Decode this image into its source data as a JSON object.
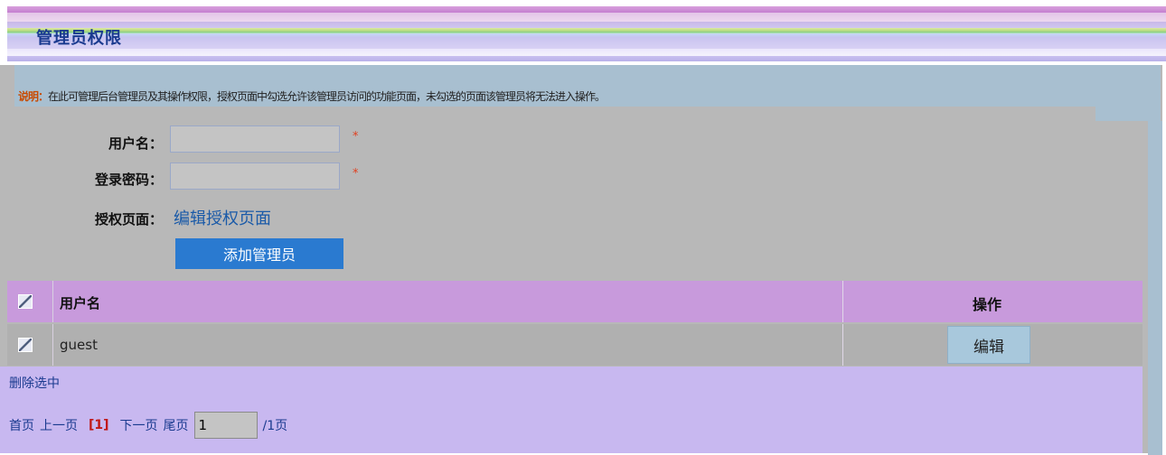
{
  "header": {
    "title": "管理员权限"
  },
  "notice": {
    "lead": "说明：",
    "text": "在此可管理后台管理员及其操作权限，授权页面中勾选允许该管理员访问的功能页面，未勾选的页面该管理员将无法进入操作。"
  },
  "form": {
    "username_label": "用户名：",
    "username_value": "",
    "password_label": "登录密码：",
    "password_value": "",
    "required_mark": "*",
    "auth_label": "授权页面：",
    "auth_link": "编辑授权页面",
    "add_button": "添加管理员"
  },
  "table": {
    "headers": {
      "username": "用户名",
      "operation": "操作"
    },
    "rows": [
      {
        "username": "guest",
        "edit_label": "编辑"
      }
    ]
  },
  "footer": {
    "delete_selected": "删除选中",
    "pager": {
      "first": "首页",
      "prev": "上一页",
      "current": "[1]",
      "next": "下一页",
      "last": "尾页",
      "page_input": "1",
      "total": "/1页"
    }
  },
  "colors": {
    "title": "#1a3a8f",
    "header_row": "#c89adc",
    "footer_bg": "#c8b8f0",
    "button_blue": "#2a7ad0",
    "current_page": "#c01818"
  }
}
